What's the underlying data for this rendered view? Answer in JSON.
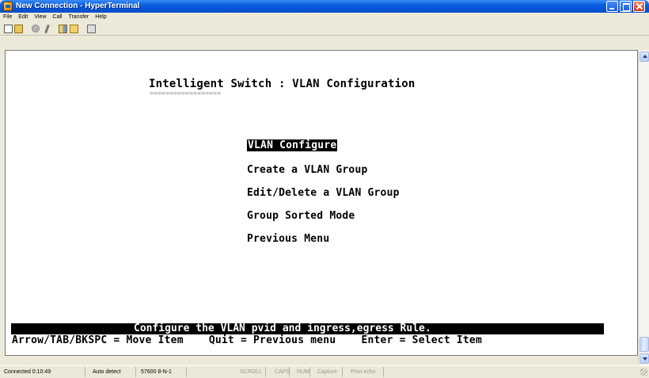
{
  "window": {
    "title": "New Connection - HyperTerminal"
  },
  "menubar": {
    "items": [
      "File",
      "Edit",
      "View",
      "Call",
      "Transfer",
      "Help"
    ]
  },
  "toolbar": {
    "icons": [
      "new-icon",
      "open-icon",
      "call-icon",
      "disconnect-icon",
      "send-icon",
      "receive-icon",
      "properties-icon"
    ]
  },
  "terminal": {
    "header_title": "Intelligent Switch : VLAN Configuration",
    "header_underline": "==================",
    "menu_items": [
      "VLAN Configure",
      "Create a VLAN Group",
      "Edit/Delete a VLAN Group",
      "Group Sorted Mode",
      "Previous Menu"
    ],
    "selected_index": 0,
    "status_line": "Configure the VLAN pvid and ingress,egress Rule.",
    "help_line": "Arrow/TAB/BKSPC = Move Item    Quit = Previous menu    Enter = Select Item"
  },
  "statusbar": {
    "connected": "Connected 0:10:49",
    "detect": "Auto detect",
    "settings": "57600 8-N-1",
    "scroll": "SCROLL",
    "caps": "CAPS",
    "num": "NUM",
    "capture": "Capture",
    "print_echo": "Print echo"
  },
  "colors": {
    "titlebar": "#0a5fe0",
    "chrome": "#ece9d8",
    "terminal_bg": "#ffffff",
    "terminal_fg": "#000000"
  }
}
